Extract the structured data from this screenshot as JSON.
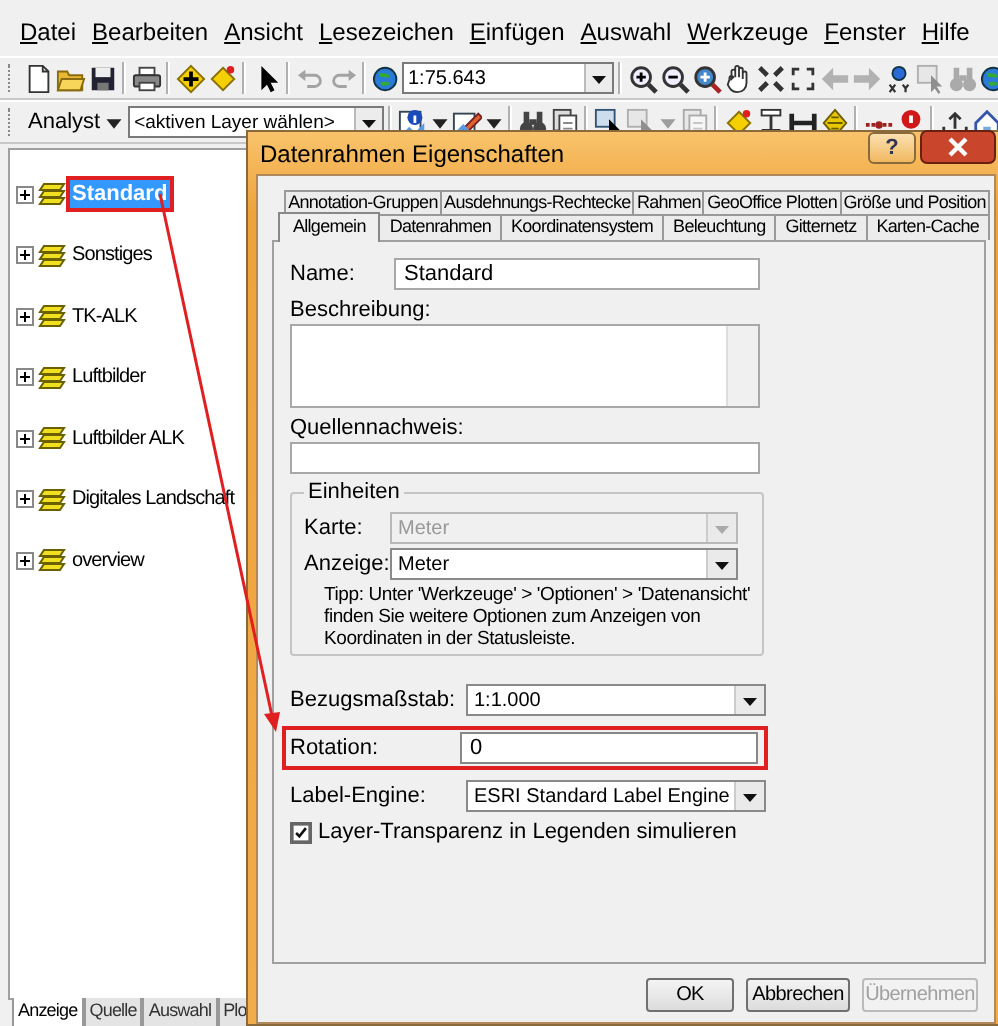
{
  "menu": [
    "Datei",
    "Bearbeiten",
    "Ansicht",
    "Lesezeichen",
    "Einfügen",
    "Auswahl",
    "Werkzeuge",
    "Fenster",
    "Hilfe"
  ],
  "toolbar_1": [
    {
      "kind": "new",
      "disabled": false
    },
    {
      "kind": "open",
      "disabled": false
    },
    {
      "kind": "save",
      "disabled": false
    },
    {
      "kind": "separator"
    },
    {
      "kind": "print",
      "disabled": false
    },
    {
      "kind": "separator"
    },
    {
      "kind": "add",
      "disabled": false
    },
    {
      "kind": "diamond",
      "disabled": false
    },
    {
      "kind": "separator"
    },
    {
      "kind": "pointer",
      "disabled": false
    },
    {
      "kind": "separator"
    },
    {
      "kind": "undo",
      "disabled": true
    },
    {
      "kind": "redo",
      "disabled": true
    },
    {
      "kind": "separator"
    },
    {
      "kind": "globe",
      "disabled": false
    },
    {
      "kind": "combo",
      "value": "1:75.643"
    },
    {
      "kind": "separator"
    },
    {
      "kind": "zoomin",
      "disabled": false
    },
    {
      "kind": "zoomout",
      "disabled": false
    },
    {
      "kind": "zoomfull",
      "disabled": false
    },
    {
      "kind": "pan",
      "disabled": false
    },
    {
      "kind": "fixin",
      "disabled": false
    },
    {
      "kind": "fixout",
      "disabled": false
    },
    {
      "kind": "back",
      "disabled": true
    },
    {
      "kind": "forward",
      "disabled": true
    },
    {
      "kind": "xy",
      "disabled": false
    },
    {
      "kind": "select",
      "disabled": true
    },
    {
      "kind": "find",
      "disabled": true
    },
    {
      "kind": "globe",
      "disabled": false
    }
  ],
  "toolbar_2": [
    {
      "kind": "menu",
      "label": "Analyst"
    },
    {
      "kind": "combo",
      "value": "<aktiven Layer wählen>"
    },
    {
      "kind": "separator"
    },
    {
      "kind": "identify",
      "disabled": false
    },
    {
      "kind": "caret",
      "disabled": false
    },
    {
      "kind": "edit",
      "disabled": false
    },
    {
      "kind": "caret",
      "disabled": false
    },
    {
      "kind": "separator"
    },
    {
      "kind": "find",
      "disabled": false
    },
    {
      "kind": "copy",
      "disabled": false
    },
    {
      "kind": "separator"
    },
    {
      "kind": "select",
      "disabled": false
    },
    {
      "kind": "select",
      "disabled": true
    },
    {
      "kind": "caret",
      "disabled": true
    },
    {
      "kind": "copy",
      "disabled": true
    },
    {
      "kind": "separator"
    },
    {
      "kind": "diamond",
      "disabled": false
    },
    {
      "kind": "measure",
      "disabled": false
    },
    {
      "kind": "ibar",
      "disabled": false
    },
    {
      "kind": "hexagon",
      "disabled": false
    },
    {
      "kind": "separator"
    },
    {
      "kind": "line",
      "disabled": false
    },
    {
      "kind": "pin",
      "disabled": false
    },
    {
      "kind": "separator"
    },
    {
      "kind": "upload",
      "disabled": false
    },
    {
      "kind": "house",
      "disabled": false
    }
  ],
  "toc": {
    "layers": [
      {
        "name": "Standard",
        "selected": true,
        "annotated": true
      },
      {
        "name": "Sonstiges",
        "selected": false,
        "annotated": false
      },
      {
        "name": "TK-ALK",
        "selected": false,
        "annotated": false
      },
      {
        "name": "Luftbilder",
        "selected": false,
        "annotated": false
      },
      {
        "name": "Luftbilder ALK",
        "selected": false,
        "annotated": false
      },
      {
        "name": "Digitales Landschaft",
        "selected": false,
        "annotated": false
      },
      {
        "name": "overview",
        "selected": false,
        "annotated": false
      }
    ],
    "tabs": [
      {
        "label": "Anzeige",
        "selected": true
      },
      {
        "label": "Quelle",
        "selected": false
      },
      {
        "label": "Auswahl",
        "selected": false
      },
      {
        "label": "Plo",
        "selected": false
      }
    ]
  },
  "dialog": {
    "title": "Datenrahmen Eigenschaften",
    "help_button": "?",
    "tab_rows": [
      [
        {
          "label": "Annotation-Gruppen",
          "selected": false
        },
        {
          "label": "Ausdehnungs-Rechtecke",
          "selected": false
        },
        {
          "label": "Rahmen",
          "selected": false
        },
        {
          "label": "GeoOffice Plotten",
          "selected": false
        },
        {
          "label": "Größe und Position",
          "selected": false
        }
      ],
      [
        {
          "label": "Allgemein",
          "selected": true
        },
        {
          "label": "Datenrahmen",
          "selected": false
        },
        {
          "label": "Koordinatensystem",
          "selected": false
        },
        {
          "label": "Beleuchtung",
          "selected": false
        },
        {
          "label": "Gitternetz",
          "selected": false
        },
        {
          "label": "Karten-Cache",
          "selected": false
        }
      ]
    ],
    "name": {
      "label": "Name:",
      "value": "Standard"
    },
    "description": {
      "label": "Beschreibung:"
    },
    "source": {
      "label": "Quellennachweis:"
    },
    "units": {
      "title": "Einheiten",
      "map": {
        "label": "Karte:",
        "value": "Meter",
        "disabled": true
      },
      "display": {
        "label": "Anzeige:",
        "value": "Meter",
        "disabled": false
      },
      "tip": "Tipp: Unter 'Werkzeuge' > 'Optionen' > 'Datenansicht' finden Sie weitere Optionen zum Anzeigen von Koordinaten in der Statusleiste."
    },
    "reference_scale": {
      "label": "Bezugsmaßstab:",
      "value": "1:1.000"
    },
    "rotation": {
      "label": "Rotation:",
      "value": "0",
      "annotated": true
    },
    "label_engine": {
      "label": "Label-Engine:",
      "value": "ESRI Standard Label Engine"
    },
    "transparency": {
      "label": "Layer-Transparenz in Legenden simulieren",
      "checked": true
    },
    "buttons": [
      {
        "label": "OK",
        "disabled": false
      },
      {
        "label": "Abbrechen",
        "disabled": false
      },
      {
        "label": "Übernehmen",
        "disabled": true
      }
    ]
  },
  "annotation_arrow": true
}
